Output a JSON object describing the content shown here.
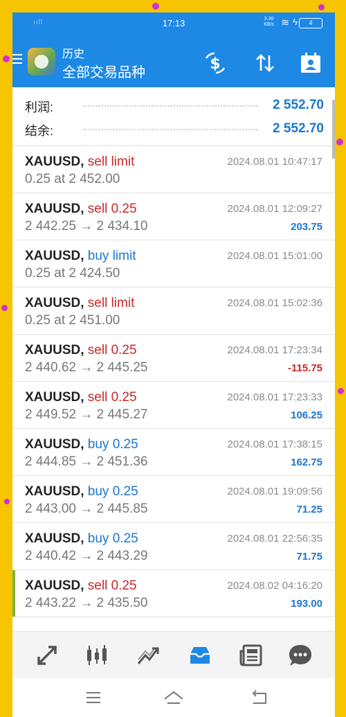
{
  "status": {
    "time": "17:13",
    "signal": "ııll",
    "net_speed": "3.30\nKB/s",
    "battery": "4"
  },
  "toolbar": {
    "title": "历史",
    "subtitle": "全部交易品种"
  },
  "summary": [
    {
      "label": "利润:",
      "value": "2 552.70"
    },
    {
      "label": "结余:",
      "value": "2 552.70"
    }
  ],
  "trades": [
    {
      "symbol": "XAUUSD,",
      "action": "sell limit",
      "side": "sell",
      "time": "2024.08.01 10:47:17",
      "prices": "0.25 at 2 452.00",
      "profit": ""
    },
    {
      "symbol": "XAUUSD,",
      "action": "sell 0.25",
      "side": "sell",
      "time": "2024.08.01 12:09:27",
      "prices": "2 442.25 → 2 434.10",
      "profit": "203.75"
    },
    {
      "symbol": "XAUUSD,",
      "action": "buy limit",
      "side": "buy",
      "time": "2024.08.01 15:01:00",
      "prices": "0.25 at 2 424.50",
      "profit": ""
    },
    {
      "symbol": "XAUUSD,",
      "action": "sell limit",
      "side": "sell",
      "time": "2024.08.01 15:02:36",
      "prices": "0.25 at 2 451.00",
      "profit": ""
    },
    {
      "symbol": "XAUUSD,",
      "action": "sell 0.25",
      "side": "sell",
      "time": "2024.08.01 17:23:34",
      "prices": "2 440.62 → 2 445.25",
      "profit": "-115.75"
    },
    {
      "symbol": "XAUUSD,",
      "action": "sell 0.25",
      "side": "sell",
      "time": "2024.08.01 17:23:33",
      "prices": "2 449.52 → 2 445.27",
      "profit": "106.25"
    },
    {
      "symbol": "XAUUSD,",
      "action": "buy 0.25",
      "side": "buy",
      "time": "2024.08.01 17:38:15",
      "prices": "2 444.85 → 2 451.36",
      "profit": "162.75"
    },
    {
      "symbol": "XAUUSD,",
      "action": "buy 0.25",
      "side": "buy",
      "time": "2024.08.01 19:09:56",
      "prices": "2 443.00 → 2 445.85",
      "profit": "71.25"
    },
    {
      "symbol": "XAUUSD,",
      "action": "buy 0.25",
      "side": "buy",
      "time": "2024.08.01 22:56:35",
      "prices": "2 440.42 → 2 443.29",
      "profit": "71.75"
    },
    {
      "symbol": "XAUUSD,",
      "action": "sell 0.25",
      "side": "sell",
      "time": "2024.08.02 04:16:20",
      "prices": "2 443.22 → 2 435.50",
      "profit": "193.00"
    }
  ],
  "colors": {
    "accent": "#1e88e5",
    "sell": "#c62828",
    "buy": "#1976d2",
    "frame": "#f7c400",
    "confetti": "#d12fd0"
  },
  "bottom_nav": [
    "quotes-icon",
    "chart-icon",
    "trade-icon",
    "history-icon",
    "news-icon",
    "chat-icon"
  ],
  "active_tab": "history-icon"
}
